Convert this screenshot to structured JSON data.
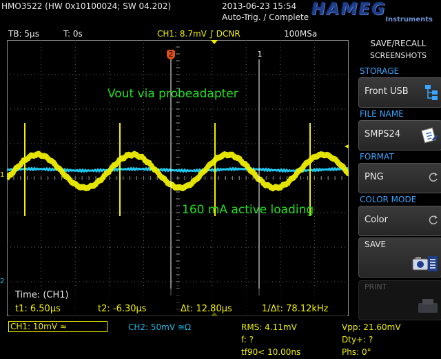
{
  "header": {
    "device": "HMO3522 (HW 0x10100024; SW 04.202)",
    "datetime": "2013-06-23 15:54",
    "trigger_status": "Auto-Trig. / Complete",
    "brand": "HAMEG",
    "brand_sub": "Instruments"
  },
  "info_bar": {
    "timebase": "TB: 5µs",
    "time_offset": "T: 0s",
    "ch1": "CH1: 8.7mV ∫ DCNR",
    "sample_rate": "100MSa"
  },
  "screen": {
    "annotation_top": "Vout via probeadapter",
    "annotation_mid": "160 mA active loading",
    "cursor1_marker": "2",
    "cursor2_marker": "1",
    "ch1_marker": "1",
    "ch2_marker": "2",
    "readout_title": "Time: (CH1)",
    "t1": "t1: 6.50µs",
    "t2": "t2: -6.30µs",
    "dt": "Δt: 12.80µs",
    "inv_dt": "1/Δt: 78.12kHz",
    "colors": {
      "ch1": "#f0f000",
      "ch2": "#20c8f0",
      "annotation": "#22dd22",
      "cursor": "#ffffff",
      "cursor_marker": "#e05010"
    }
  },
  "panel": {
    "title_line1": "SAVE/RECALL",
    "title_line2": "SCREENSHOTS",
    "storage_label": "STORAGE",
    "storage_value": "Front USB",
    "filename_label": "FILE NAME",
    "filename_value": "SMPS24",
    "format_label": "FORMAT",
    "format_value": "PNG",
    "colormode_label": "COLOR MODE",
    "colormode_value": "Color",
    "save_label": "SAVE",
    "print_label": "PRINT"
  },
  "bottom": {
    "ch1_setting": "CH1: 10mV ≈",
    "ch2_setting": "CH2: 50mV ≅Ω",
    "rms": "RMS: 4.11mV",
    "freq": "f: ?",
    "tf90": "tf90< 10.00ns",
    "vpp": "Vpp: 21.60mV",
    "duty": "Dty+: ?",
    "phase": "Phs: 0°"
  }
}
